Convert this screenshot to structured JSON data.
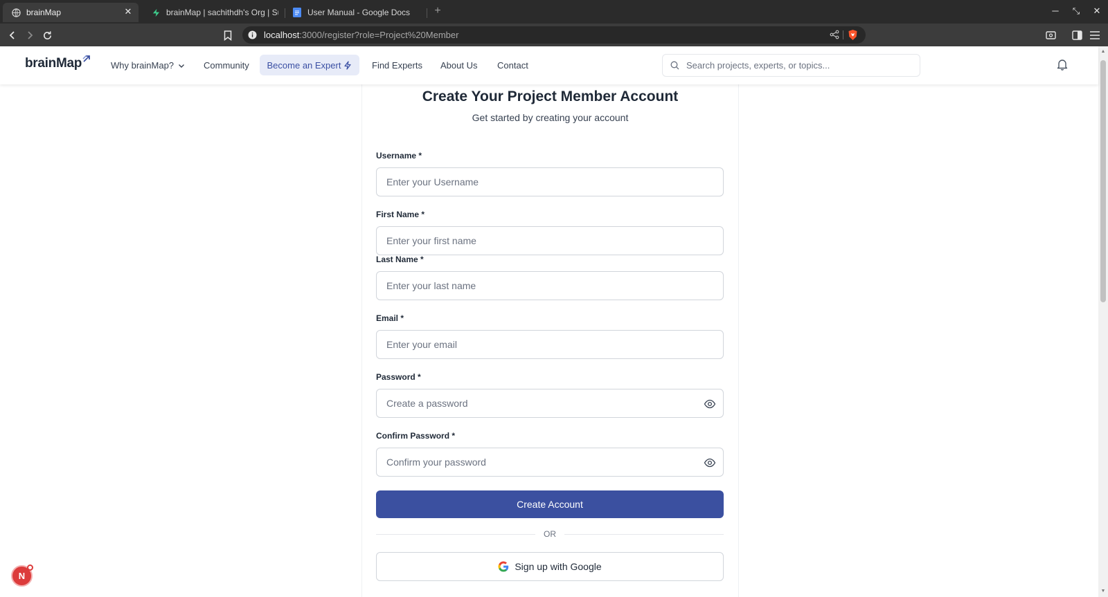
{
  "browser": {
    "tabs": [
      {
        "title": "brainMap",
        "icon": "globe-icon"
      },
      {
        "title": "brainMap | sachithdh's Org | Su",
        "icon": "supabase-icon"
      },
      {
        "title": "User Manual - Google Docs",
        "icon": "docs-icon"
      }
    ],
    "url_host": "localhost",
    "url_rest": ":3000/register?role=Project%20Member"
  },
  "header": {
    "logo": "brainMap",
    "nav": {
      "why": "Why brainMap?",
      "community": "Community",
      "become_expert": "Become an Expert",
      "find_experts": "Find Experts",
      "about": "About Us",
      "contact": "Contact"
    },
    "search_placeholder": "Search projects, experts, or topics..."
  },
  "form": {
    "title": "Create Your Project Member Account",
    "subtitle": "Get started by creating your account",
    "fields": {
      "username": {
        "label": "Username *",
        "placeholder": "Enter your Username"
      },
      "first_name": {
        "label": "First Name *",
        "placeholder": "Enter your first name"
      },
      "last_name": {
        "label": "Last Name *",
        "placeholder": "Enter your last name"
      },
      "email": {
        "label": "Email *",
        "placeholder": "Enter your email"
      },
      "password": {
        "label": "Password *",
        "placeholder": "Create a password"
      },
      "confirm_password": {
        "label": "Confirm Password *",
        "placeholder": "Confirm your password"
      }
    },
    "submit_label": "Create Account",
    "divider_text": "OR",
    "google_label": "Sign up with Google"
  },
  "dev_badge": "N",
  "colors": {
    "primary": "#3b50a0",
    "nav_highlight_bg": "#e7ebf8",
    "nav_highlight_text": "#3a4fa3",
    "badge": "#dc3b3b"
  }
}
